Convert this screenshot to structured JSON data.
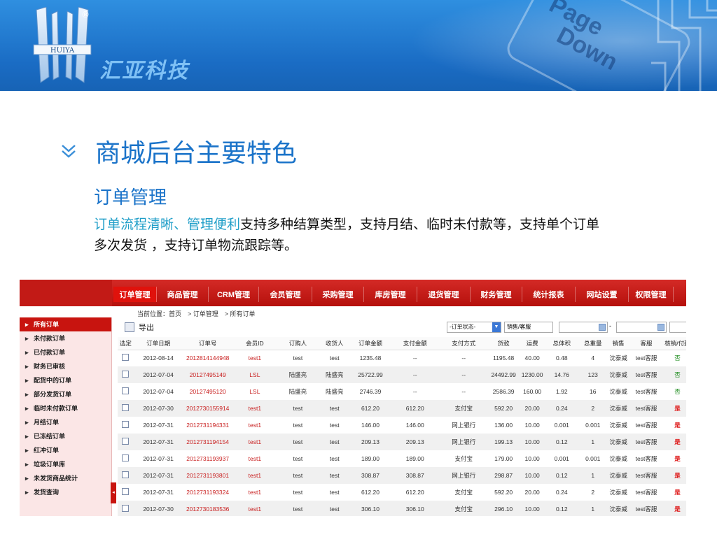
{
  "banner": {
    "brand": "汇亚科技",
    "logo_text": "HUIYA",
    "reg_mark": "®",
    "deco_text": [
      "Page",
      "Down"
    ]
  },
  "heading": {
    "title": "商城后台主要特色",
    "subtitle": "订单管理",
    "desc_highlight": "订单流程清晰、管理便利",
    "desc_rest": "支持多种结算类型，支持月结、临时未付款等，支持单个订单多次发货 ，支持订单物流跟踪等。"
  },
  "app": {
    "nav_tabs": [
      "订单管理",
      "商品管理",
      "CRM管理",
      "会员管理",
      "采购管理",
      "库房管理",
      "退货管理",
      "财务管理",
      "统计报表",
      "网站设置",
      "权限管理"
    ],
    "breadcrumb": "当前位置：首页　> 订单管理　> 所有订单",
    "left_menu": [
      "所有订单",
      "未付款订单",
      "已付款订单",
      "财务已审核",
      "配货中的订单",
      "部分发货订单",
      "临时未付款订单",
      "月结订单",
      "已冻结订单",
      "红冲订单",
      "垃圾订单库",
      "未发货商品统计",
      "发货查询"
    ],
    "export_label": "导出",
    "status_select": "-订单状态-",
    "staff_input": "销售/客服",
    "columns": [
      "选定",
      "订单日期",
      "订单号",
      "会员ID",
      "订购人",
      "收货人",
      "订单金额",
      "支付金额",
      "支付方式",
      "货款",
      "运费",
      "总体积",
      "总重量",
      "销售",
      "客服",
      "核销/付款"
    ],
    "rows": [
      [
        "2012-08-14",
        "2012814144948",
        "test1",
        "test",
        "test",
        "1235.48",
        "--",
        "--",
        "1195.48",
        "40.00",
        "0.48",
        "4",
        "沈泰威",
        "test客服",
        "否"
      ],
      [
        "2012-07-04",
        "20127495149",
        "LSL",
        "陆盛亮",
        "陆盛亮",
        "25722.99",
        "--",
        "--",
        "24492.99",
        "1230.00",
        "14.76",
        "123",
        "沈泰威",
        "test客服",
        "否"
      ],
      [
        "2012-07-04",
        "20127495120",
        "LSL",
        "陆盛亮",
        "陆盛亮",
        "2746.39",
        "--",
        "--",
        "2586.39",
        "160.00",
        "1.92",
        "16",
        "沈泰威",
        "test客服",
        "否"
      ],
      [
        "2012-07-30",
        "2012730155914",
        "test1",
        "test",
        "test",
        "612.20",
        "612.20",
        "支付宝",
        "592.20",
        "20.00",
        "0.24",
        "2",
        "沈泰威",
        "test客服",
        "是"
      ],
      [
        "2012-07-31",
        "2012731194331",
        "test1",
        "test",
        "test",
        "146.00",
        "146.00",
        "网上银行",
        "136.00",
        "10.00",
        "0.001",
        "0.001",
        "沈泰威",
        "test客服",
        "是"
      ],
      [
        "2012-07-31",
        "2012731194154",
        "test1",
        "test",
        "test",
        "209.13",
        "209.13",
        "网上银行",
        "199.13",
        "10.00",
        "0.12",
        "1",
        "沈泰威",
        "test客服",
        "是"
      ],
      [
        "2012-07-31",
        "2012731193937",
        "test1",
        "test",
        "test",
        "189.00",
        "189.00",
        "支付宝",
        "179.00",
        "10.00",
        "0.001",
        "0.001",
        "沈泰威",
        "test客服",
        "是"
      ],
      [
        "2012-07-31",
        "2012731193801",
        "test1",
        "test",
        "test",
        "308.87",
        "308.87",
        "网上银行",
        "298.87",
        "10.00",
        "0.12",
        "1",
        "沈泰威",
        "test客服",
        "是"
      ],
      [
        "2012-07-31",
        "2012731193324",
        "test1",
        "test",
        "test",
        "612.20",
        "612.20",
        "支付宝",
        "592.20",
        "20.00",
        "0.24",
        "2",
        "沈泰威",
        "test客服",
        "是"
      ],
      [
        "2012-07-30",
        "2012730183536",
        "test1",
        "test",
        "test",
        "306.10",
        "306.10",
        "支付宝",
        "296.10",
        "10.00",
        "0.12",
        "1",
        "沈泰威",
        "test客服",
        "是"
      ]
    ]
  },
  "colors": {
    "brand_blue": "#1a73c9",
    "app_red": "#c8140f",
    "highlight_teal": "#1f9ec8"
  }
}
